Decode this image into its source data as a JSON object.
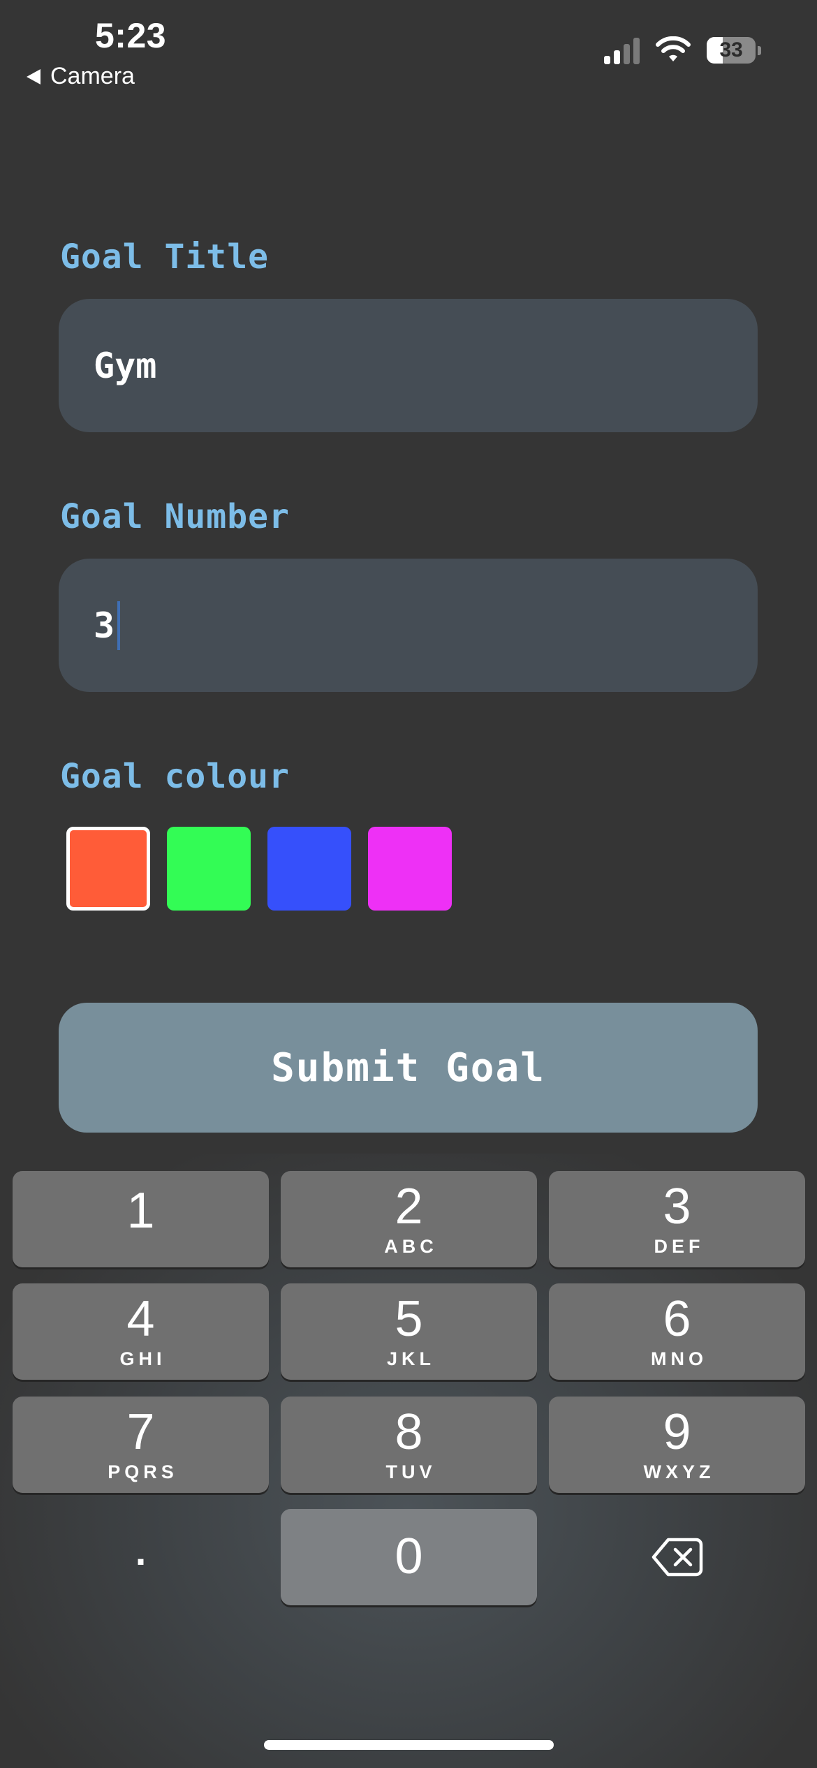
{
  "status_bar": {
    "time": "5:23",
    "back_label": "Camera",
    "battery_level": "33",
    "signal_icon": "cellular-signal-icon",
    "wifi_icon": "wifi-icon"
  },
  "form": {
    "title_label": "Goal Title",
    "title_value": "Gym",
    "number_label": "Goal Number",
    "number_value": "3",
    "colour_label": "Goal colour",
    "colours": [
      {
        "hex": "#ff5c38",
        "selected": true
      },
      {
        "hex": "#33fc55",
        "selected": false
      },
      {
        "hex": "#3650fb",
        "selected": false
      },
      {
        "hex": "#ee30f6",
        "selected": false
      }
    ],
    "submit_label": "Submit Goal"
  },
  "keypad": {
    "keys": [
      {
        "digit": "1",
        "letters": ""
      },
      {
        "digit": "2",
        "letters": "ABC"
      },
      {
        "digit": "3",
        "letters": "DEF"
      },
      {
        "digit": "4",
        "letters": "GHI"
      },
      {
        "digit": "5",
        "letters": "JKL"
      },
      {
        "digit": "6",
        "letters": "MNO"
      },
      {
        "digit": "7",
        "letters": "PQRS"
      },
      {
        "digit": "8",
        "letters": "TUV"
      },
      {
        "digit": "9",
        "letters": "WXYZ"
      }
    ],
    "decimal": ".",
    "zero": "0",
    "delete_icon": "backspace-icon"
  }
}
